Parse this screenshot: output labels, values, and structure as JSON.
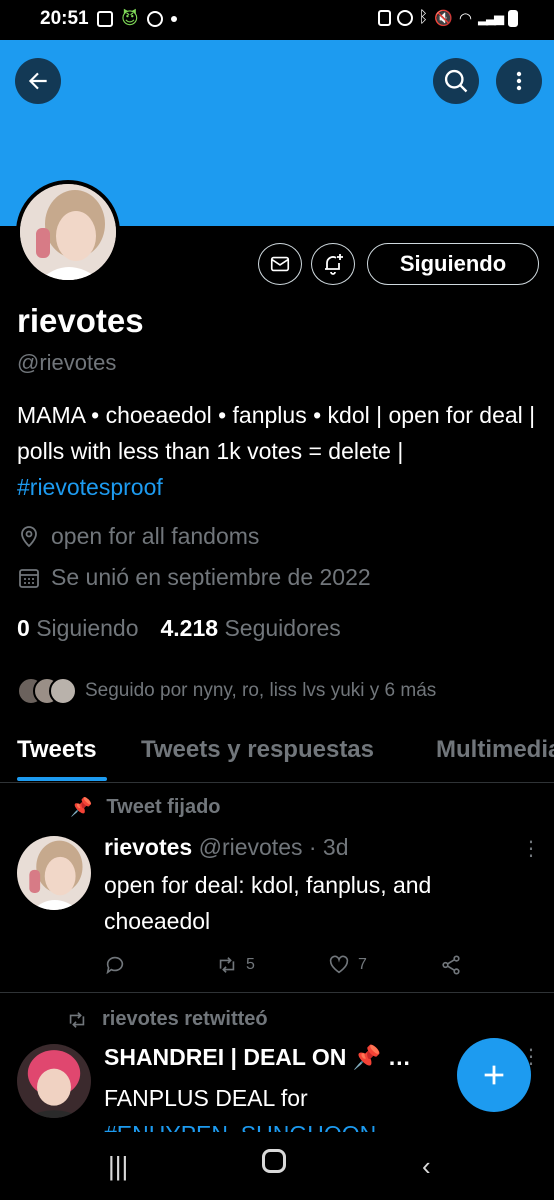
{
  "status_bar": {
    "time": "20:51"
  },
  "header": {
    "back_icon": "arrow-left-icon",
    "search_icon": "search-icon",
    "more_icon": "more-vertical-icon",
    "banner_color": "#1d9bf0"
  },
  "profile": {
    "name": "rievotes",
    "handle": "@rievotes",
    "bio_text": "MAMA • choeaedol • fanplus • kdol | open for deal | polls with less than 1k votes = delete | ",
    "bio_hashtag": "#rievotesproof",
    "location": "open for all fandoms",
    "joined": "Se unió en septiembre de 2022",
    "following_count": "0",
    "following_label": "Siguiendo",
    "followers_count": "4.218",
    "followers_label": "Seguidores",
    "followed_by": "Seguido por nyny, ro, liss lvs yuki y 6 más",
    "follow_button": "Siguiendo"
  },
  "tabs": [
    "Tweets",
    "Tweets y respuestas",
    "Multimedia"
  ],
  "tweets": [
    {
      "context": "Tweet fijado",
      "name": "rievotes",
      "meta": "@rievotes · 3d",
      "text": "open for deal: kdol, fanplus, and choeaedol",
      "retweets": "5",
      "likes": "7"
    },
    {
      "context": "rievotes retwitteó",
      "name": "SHANDREI | DEAL ON 📌 …",
      "text_line1": "FANPLUS DEAL for",
      "text_line2": "#ENHYPEN_SUNGHOON"
    }
  ],
  "colors": {
    "accent": "#1d9bf0",
    "muted": "#71767b",
    "background": "#000000"
  }
}
